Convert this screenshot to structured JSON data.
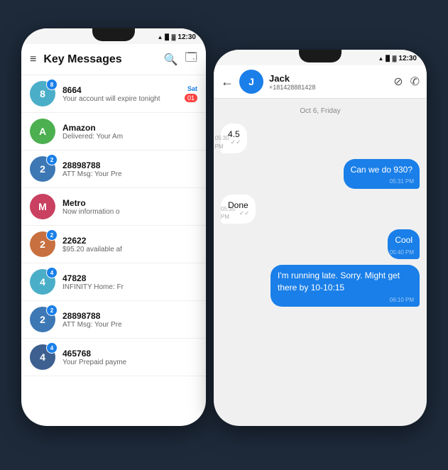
{
  "statusBar": {
    "time": "12:30"
  },
  "backPhone": {
    "header": {
      "menuIcon": "≡",
      "title": "Key Messages",
      "searchIcon": "🔍",
      "editIcon": "🖊"
    },
    "messages": [
      {
        "id": "8664",
        "sender": "8664",
        "preview": "Your account will expire tonight",
        "date": "Sat",
        "badge": "8",
        "avatarColor": "#4baec8",
        "avatarLabel": "8"
      },
      {
        "id": "amazon",
        "sender": "Amazon",
        "preview": "Delivered: Your Am",
        "date": "",
        "badge": "",
        "avatarColor": "#4caf50",
        "avatarLabel": "A"
      },
      {
        "id": "28898788",
        "sender": "28898788",
        "preview": "ATT Msg: Your Pre",
        "date": "",
        "badge": "2",
        "avatarColor": "#3d78b5",
        "avatarLabel": "2"
      },
      {
        "id": "metro",
        "sender": "Metro",
        "preview": "Now information o",
        "date": "",
        "badge": "",
        "avatarColor": "#c94060",
        "avatarLabel": "M"
      },
      {
        "id": "22622",
        "sender": "22622",
        "preview": "$95.20 available af",
        "date": "",
        "badge": "2",
        "avatarColor": "#c87040",
        "avatarLabel": "2"
      },
      {
        "id": "47828",
        "sender": "47828",
        "preview": "INFINITY Home: Fr",
        "date": "",
        "badge": "4",
        "avatarColor": "#4baec8",
        "avatarLabel": "4"
      },
      {
        "id": "28898788b",
        "sender": "28898788",
        "preview": "ATT Msg: Your Pre",
        "date": "",
        "badge": "2",
        "avatarColor": "#3d78b5",
        "avatarLabel": "2"
      },
      {
        "id": "465768",
        "sender": "465768",
        "preview": "Your Prepaid payme",
        "date": "",
        "badge": "4",
        "avatarColor": "#3d6090",
        "avatarLabel": "4"
      }
    ]
  },
  "frontPhone": {
    "header": {
      "backArrow": "←",
      "avatarLabel": "J",
      "avatarColor": "#1a7fe8",
      "contactName": "Jack",
      "contactPhone": "+181428881428",
      "blockIcon": "⊘",
      "callIcon": "✆"
    },
    "dateDivider": "Oct 6, Friday",
    "messages": [
      {
        "id": "msg1",
        "type": "incoming",
        "text": "4.5",
        "time": "05:30 PM",
        "hasCheck": true
      },
      {
        "id": "msg2",
        "type": "outgoing",
        "text": "Can we do 930?",
        "time": "05:31 PM",
        "hasCheck": false
      },
      {
        "id": "msg3",
        "type": "incoming",
        "text": "Done",
        "time": "05:35 PM",
        "hasCheck": true
      },
      {
        "id": "msg4",
        "type": "outgoing",
        "text": "Cool",
        "time": "05:40 PM",
        "hasCheck": false
      },
      {
        "id": "msg5",
        "type": "outgoing",
        "text": "I'm running late. Sorry. Might get there by 10-10:15",
        "time": "06:10 PM",
        "hasCheck": false
      }
    ]
  }
}
